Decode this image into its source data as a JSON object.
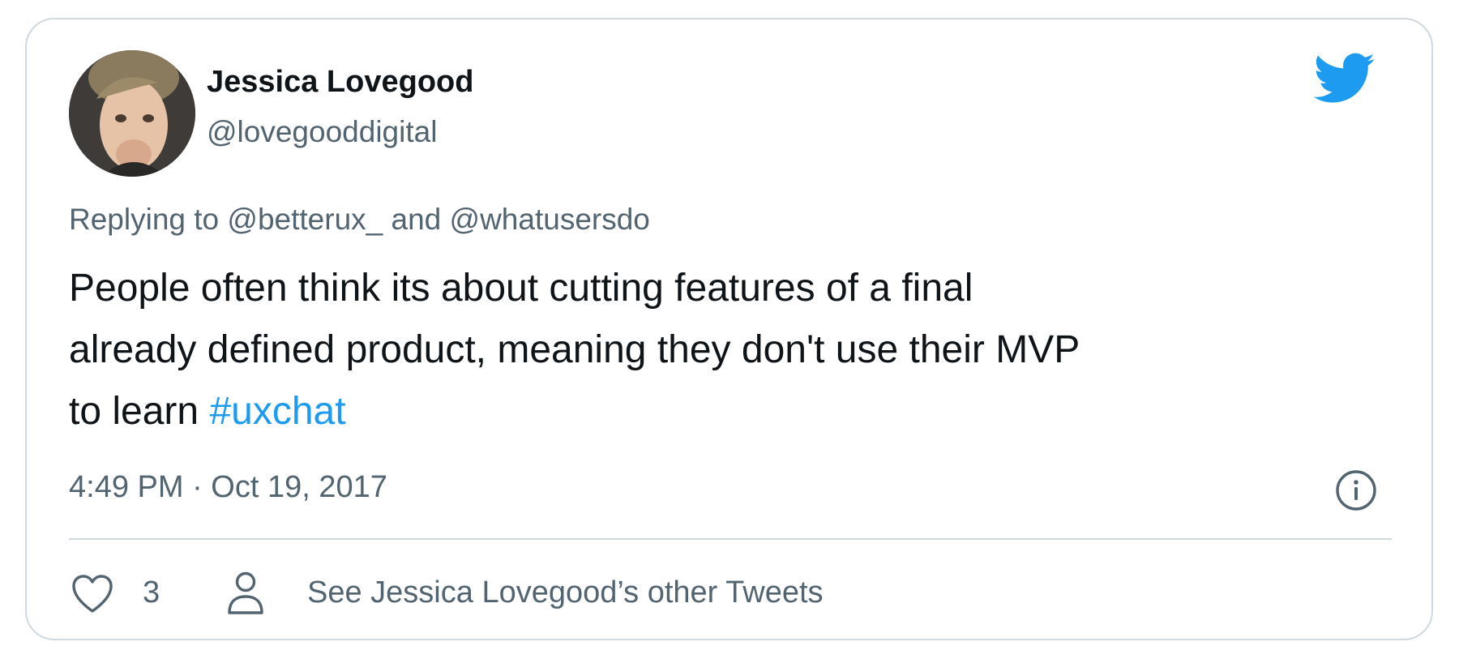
{
  "tweet": {
    "author_name": "Jessica Lovegood",
    "author_handle": "@lovegooddigital",
    "replying_prefix": "Replying to ",
    "reply_to_1": "@betterux_",
    "reply_and": " and ",
    "reply_to_2": "@whatusersdo",
    "text_line_1": "People often think its about cutting features of a final",
    "text_line_2": "already defined product, meaning they don't use their MVP",
    "text_line_3": "to learn ",
    "hashtag": "#uxchat",
    "timestamp": "4:49 PM · Oct 19, 2017",
    "like_count": "3",
    "other_tweets_label": "See Jessica Lovegood’s other Tweets"
  },
  "icons": {
    "brand": "twitter-bird-icon",
    "info": "info-icon",
    "like": "heart-icon",
    "profile": "person-icon"
  },
  "colors": {
    "brand_blue": "#1d9bf0",
    "text_primary": "#0f1419",
    "text_secondary": "#536471",
    "border": "#cfd9de"
  }
}
